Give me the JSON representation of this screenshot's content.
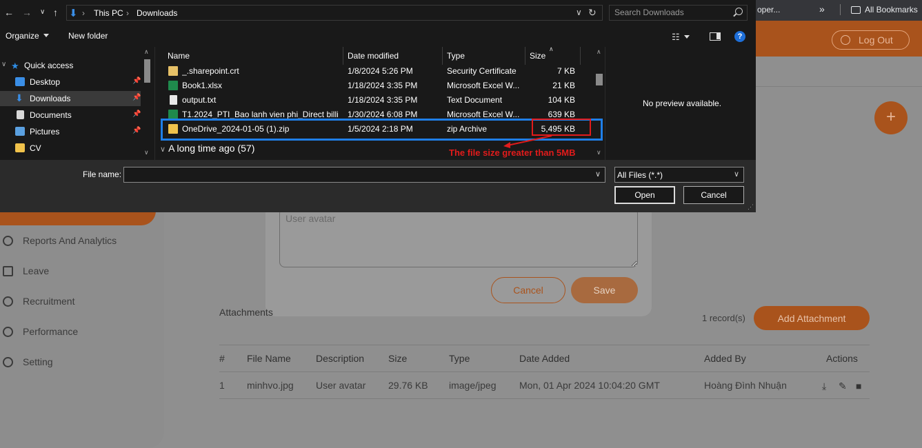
{
  "browser": {
    "tab_fragment": "oper...",
    "more_label": "»",
    "bookmarks_label": "All Bookmarks"
  },
  "app": {
    "logout_label": "Log Out",
    "fab_label": "+",
    "sidebar": [
      {
        "label": "Reports And Analytics",
        "icon": "chart-icon"
      },
      {
        "label": "Leave",
        "icon": "calendar-icon"
      },
      {
        "label": "Recruitment",
        "icon": "recruit-icon"
      },
      {
        "label": "Performance",
        "icon": "performance-icon"
      },
      {
        "label": "Setting",
        "icon": "gear-icon"
      }
    ],
    "modal": {
      "description_value": "User avatar",
      "cancel_label": "Cancel",
      "save_label": "Save"
    },
    "attachments": {
      "title": "Attachments",
      "records": "1 record(s)",
      "add_label": "Add Attachment",
      "headers": [
        "#",
        "File Name",
        "Description",
        "Size",
        "Type",
        "Date Added",
        "Added By",
        "Actions"
      ],
      "rows": [
        [
          "1",
          "minhvo.jpg",
          "User avatar",
          "29.76 KB",
          "image/jpeg",
          "Mon, 01 Apr 2024 10:04:20 GMT",
          "Hoàng Đình Nhuận"
        ]
      ]
    }
  },
  "dialog": {
    "breadcrumb": [
      "This PC",
      "Downloads"
    ],
    "search_placeholder": "Search Downloads",
    "toolbar": {
      "organize": "Organize",
      "new_folder": "New folder",
      "help": "?"
    },
    "nav": {
      "quick_access": "Quick access",
      "items": [
        {
          "label": "Desktop",
          "icon": "desktop-icon",
          "color": "#3a8ee6",
          "pinned": true
        },
        {
          "label": "Downloads",
          "icon": "download-icon",
          "color": "#3a8ee6",
          "pinned": true,
          "selected": true
        },
        {
          "label": "Documents",
          "icon": "document-icon",
          "color": "#d8d8d8",
          "pinned": true
        },
        {
          "label": "Pictures",
          "icon": "pictures-icon",
          "color": "#5aa0e0",
          "pinned": true
        },
        {
          "label": "CV",
          "icon": "folder-icon",
          "color": "#f0c24b",
          "pinned": false
        }
      ]
    },
    "columns": [
      "Name",
      "Date modified",
      "Type",
      "Size"
    ],
    "files": [
      {
        "name": "_.sharepoint.crt",
        "date": "1/8/2024 5:26 PM",
        "type": "Security Certificate",
        "size": "7 KB",
        "icon": "certificate-icon",
        "color": "#e6c067"
      },
      {
        "name": "Book1.xlsx",
        "date": "1/18/2024 3:35 PM",
        "type": "Microsoft Excel W...",
        "size": "21 KB",
        "icon": "excel-icon",
        "color": "#1f8a4c"
      },
      {
        "name": "output.txt",
        "date": "1/18/2024 3:35 PM",
        "type": "Text Document",
        "size": "104 KB",
        "icon": "text-file-icon",
        "color": "#e8e8e8"
      },
      {
        "name": "T1.2024_PTI_Bao lanh vien phi_Direct billi...",
        "date": "1/30/2024 6:08 PM",
        "type": "Microsoft Excel W...",
        "size": "639 KB",
        "icon": "excel-icon",
        "color": "#1f8a4c"
      },
      {
        "name": "OneDrive_2024-01-05 (1).zip",
        "date": "1/5/2024 2:18 PM",
        "type": "zip Archive",
        "size": "5,495 KB",
        "icon": "zip-icon",
        "color": "#f0c24b"
      }
    ],
    "group_label": "A long time ago (57)",
    "preview_text": "No preview available.",
    "filename_label": "File name:",
    "filename_value": "",
    "filter_value": "All Files (*.*)",
    "open_label": "Open",
    "cancel_label": "Cancel"
  },
  "annotation": {
    "text": "The file size greater than 5MB",
    "highlight_color": "#1f7fe8",
    "alert_color": "#e21b1b"
  }
}
